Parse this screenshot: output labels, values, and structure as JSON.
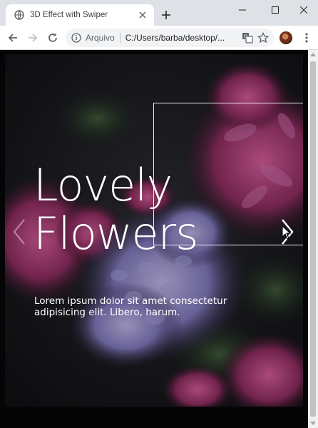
{
  "browser": {
    "tab_title": "3D Effect with Swiper",
    "omnibox_scheme": "Arquivo",
    "omnibox_url": "C:/Users/barba/desktop/..."
  },
  "slide": {
    "headline_line1": "Lovely",
    "headline_line2": "Flowers",
    "description": "Lorem ipsum dolor sit amet consectetur adipisicing elit. Libero, harum."
  },
  "icons": {
    "favicon": "globe-icon",
    "close_tab": "close-icon",
    "new_tab": "plus-icon",
    "back": "arrow-left-icon",
    "forward": "arrow-right-icon",
    "reload": "reload-icon",
    "site_info": "info-icon",
    "translate": "translate-icon",
    "bookmark": "star-icon",
    "menu": "kebab-menu-icon",
    "slider_prev": "chevron-left-icon",
    "slider_next": "chevron-right-icon"
  },
  "colors": {
    "chrome_bg": "#dee1e6",
    "slide_bg": "#15161a",
    "flower_magenta": "#a0356e",
    "flower_lavender": "#8e86c0",
    "text": "#ffffff"
  }
}
